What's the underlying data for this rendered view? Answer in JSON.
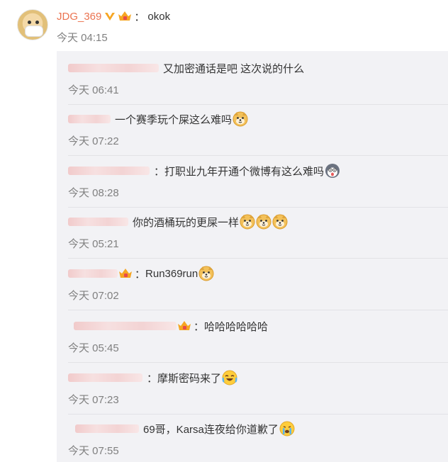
{
  "main_comment": {
    "username": "JDG_369",
    "separator": "：",
    "text": "okok",
    "time": "今天 04:15"
  },
  "replies": [
    {
      "sep": "",
      "text": "又加密通话是吧 这次说的什么",
      "time": "今天 06:41",
      "emojis": []
    },
    {
      "sep": "",
      "text": "一个赛季玩个屎这么难吗",
      "time": "今天 07:22",
      "emojis": [
        "doge-emoji"
      ]
    },
    {
      "sep": "：",
      "text": "打职业九年开通个微博有这么难吗",
      "time": "今天 08:28",
      "emojis": [
        "shocked-husky-emoji"
      ]
    },
    {
      "sep": "",
      "text": "你的酒桶玩的更屎一样",
      "time": "今天 05:21",
      "emojis": [
        "doge-emoji",
        "doge-emoji",
        "doge-emoji"
      ]
    },
    {
      "sep": "：",
      "text": "Run369run",
      "time": "今天 07:02",
      "emojis": [
        "doge-emoji"
      ],
      "badge": true
    },
    {
      "sep": "：",
      "text": "哈哈哈哈哈哈",
      "time": "今天 05:45",
      "emojis": [],
      "badge": true
    },
    {
      "sep": "：",
      "text": "摩斯密码来了",
      "time": "今天 07:23",
      "emojis": [
        "laughing-tears-emoji"
      ]
    },
    {
      "sep": "",
      "text": "69哥，Karsa连夜给你道歉了",
      "time": "今天 07:55",
      "emojis": [
        "crying-emoji"
      ]
    }
  ]
}
